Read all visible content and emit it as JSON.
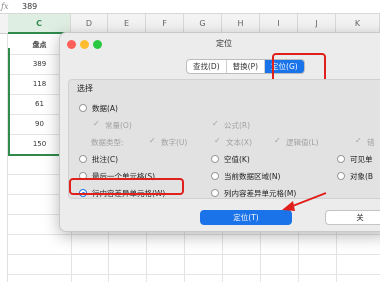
{
  "formula_bar": {
    "fx": "ƒx",
    "value": "389"
  },
  "columns": [
    "C",
    "D",
    "E",
    "F",
    "G",
    "H",
    "I",
    "J",
    "K"
  ],
  "sheet": {
    "header": "盘点",
    "values": [
      "389",
      "118",
      "61",
      "90",
      "150"
    ]
  },
  "dialog": {
    "title": "定位",
    "tabs": [
      "查找(D)",
      "替换(P)",
      "定位(G)"
    ],
    "active_tab": "定位(G)",
    "section_label": "选择",
    "options": {
      "data": "数据(A)",
      "constant": "常量(O)",
      "formula": "公式(R)",
      "data_type_label": "数据类型:",
      "type_number": "数字(U)",
      "type_text": "文本(X)",
      "type_logical": "逻辑值(L)",
      "type_error": "错",
      "comment": "批注(C)",
      "blank": "空值(K)",
      "visible": "可见单",
      "last_cell": "最后一个单元格(S)",
      "current_region": "当前数据区域(N)",
      "object": "对象(B",
      "row_diff": "行内容差异单元格(W)",
      "col_diff": "列内容差异单元格(M)"
    },
    "selected_option": "行内容差异单元格(W)",
    "buttons": {
      "locate": "定位(T)",
      "close": "关"
    }
  },
  "colors": {
    "accent": "#1a73e8",
    "highlight": "#e0201d",
    "sheet_green": "#2f8a4c"
  }
}
